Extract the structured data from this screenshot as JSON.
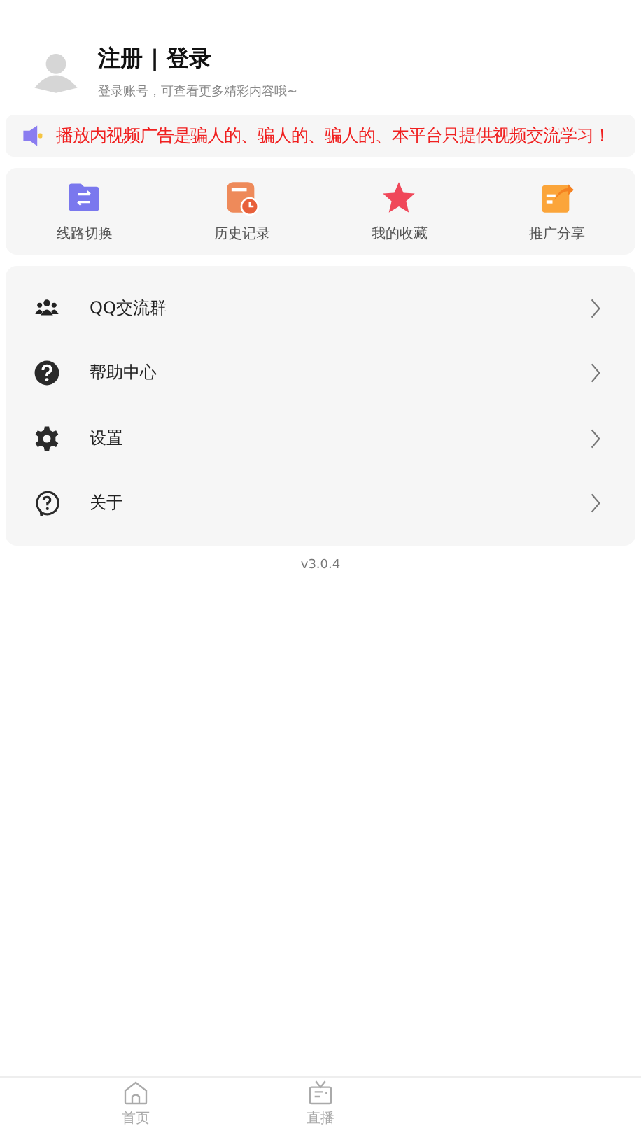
{
  "profile": {
    "title": "注册 | 登录",
    "subtitle": "登录账号，可查看更多精彩内容哦~"
  },
  "notice": {
    "text": "播放内视频广告是骗人的、骗人的、骗人的、本平台只提供视频交流学习！"
  },
  "shortcuts": [
    {
      "kind": "route",
      "label": "线路切换"
    },
    {
      "kind": "history",
      "label": "历史记录"
    },
    {
      "kind": "favorite",
      "label": "我的收藏"
    },
    {
      "kind": "share",
      "label": "推广分享"
    }
  ],
  "menu": [
    {
      "kind": "group",
      "label": "QQ交流群"
    },
    {
      "kind": "help",
      "label": "帮助中心"
    },
    {
      "kind": "settings",
      "label": "设置"
    },
    {
      "kind": "about",
      "label": "关于"
    }
  ],
  "version": "v3.0.4",
  "tab_bar": [
    {
      "kind": "home",
      "label": "首页"
    },
    {
      "kind": "tv",
      "label": "直播"
    }
  ]
}
